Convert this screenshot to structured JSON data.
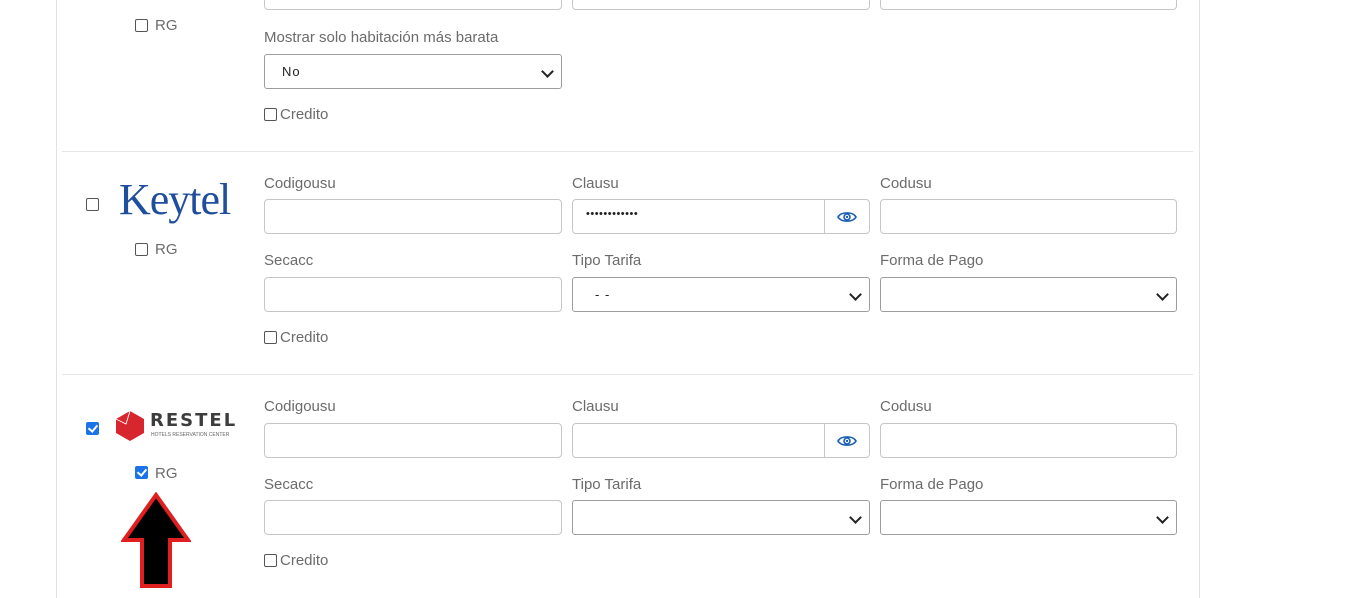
{
  "top_section": {
    "rg_label": "RG",
    "cheapest_label": "Mostrar solo habitación más barata",
    "cheapest_value": "No",
    "credit_label": "Credito"
  },
  "keytel": {
    "logo_text": "Keytel",
    "rg_label": "RG",
    "codigousu_label": "Codigousu",
    "clausu_label": "Clausu",
    "clausu_value": "••••••••••••",
    "codusu_label": "Codusu",
    "secacc_label": "Secacc",
    "tipo_tarifa_label": "Tipo Tarifa",
    "tipo_tarifa_value": "- -",
    "forma_pago_label": "Forma de Pago",
    "forma_pago_value": "",
    "credit_label": "Credito"
  },
  "restel": {
    "logo_text": "RESTEL",
    "logo_subtext": "HOTELS RESERVATION CENTER",
    "rg_label": "RG",
    "codigousu_label": "Codigousu",
    "clausu_label": "Clausu",
    "codusu_label": "Codusu",
    "secacc_label": "Secacc",
    "tipo_tarifa_label": "Tipo Tarifa",
    "tipo_tarifa_value": "",
    "forma_pago_label": "Forma de Pago",
    "forma_pago_value": "",
    "credit_label": "Credito",
    "selected": true,
    "rg_checked": true
  },
  "colors": {
    "checkbox_checked": "#1a73e8",
    "keytel_blue": "#1f4f9c",
    "restel_red": "#d8262f",
    "arrow_red": "#e02020"
  }
}
